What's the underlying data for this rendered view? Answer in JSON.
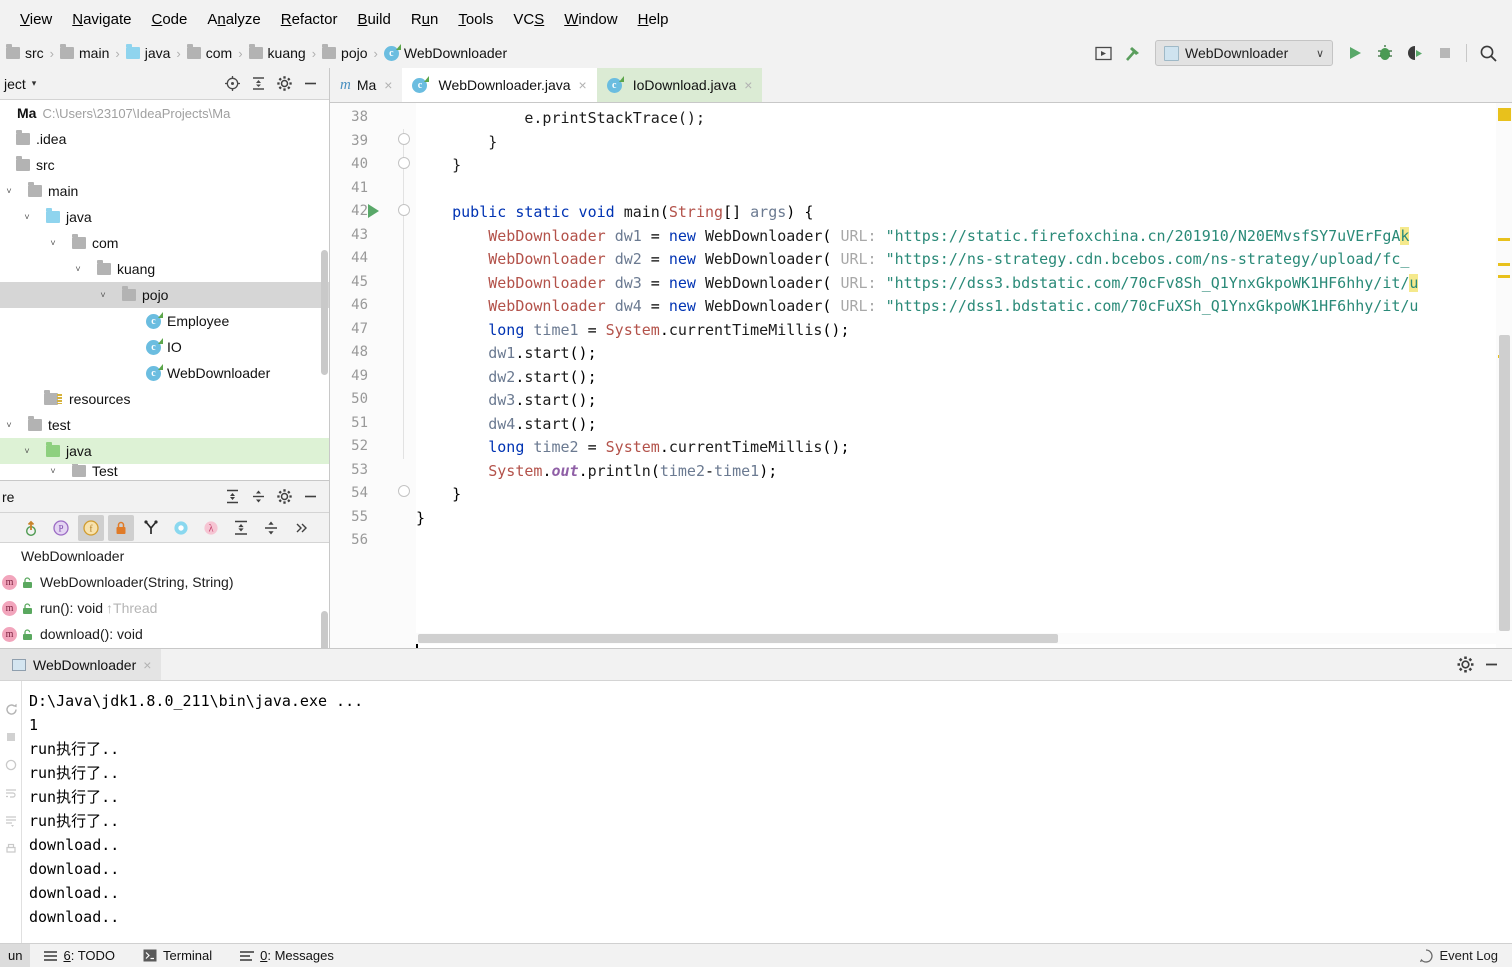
{
  "menu": {
    "items": [
      "View",
      "Navigate",
      "Code",
      "Analyze",
      "Refactor",
      "Build",
      "Run",
      "Tools",
      "VCS",
      "Window",
      "Help"
    ]
  },
  "breadcrumb": {
    "items": [
      {
        "label": "src",
        "icon": "folder-icon"
      },
      {
        "label": "main",
        "icon": "folder-icon"
      },
      {
        "label": "java",
        "icon": "folder-source-icon"
      },
      {
        "label": "com",
        "icon": "folder-icon"
      },
      {
        "label": "kuang",
        "icon": "folder-icon"
      },
      {
        "label": "pojo",
        "icon": "folder-icon"
      },
      {
        "label": "WebDownloader",
        "icon": "java-class-icon"
      }
    ],
    "separator": "›"
  },
  "toolbar": {
    "run_config_name": "WebDownloader",
    "run_config_chevron": "∨",
    "buttons": [
      {
        "name": "open-terminal-icon",
        "title": "Terminal"
      },
      {
        "name": "build-hammer-icon",
        "title": "Build"
      },
      {
        "name": "run-icon",
        "title": "Run"
      },
      {
        "name": "debug-icon",
        "title": "Debug"
      },
      {
        "name": "run-coverage-icon",
        "title": "Run with Coverage"
      },
      {
        "name": "stop-icon",
        "title": "Stop"
      },
      {
        "name": "search-icon",
        "title": "Search Everywhere"
      }
    ]
  },
  "project_panel": {
    "title": "ject",
    "caret": "▾",
    "tree": [
      {
        "indent": 0,
        "twist": "",
        "label": "Ma",
        "bold": true,
        "path": "C:\\Users\\23107\\IdeaProjects\\Ma",
        "icon": "none",
        "state": "none"
      },
      {
        "indent": 0,
        "twist": "",
        "label": ".idea",
        "icon": "folder-icon",
        "state": "none"
      },
      {
        "indent": 0,
        "twist": "",
        "label": "src",
        "icon": "folder-icon",
        "state": "none"
      },
      {
        "indent": 1,
        "twist": "˅",
        "label": "main",
        "icon": "folder-icon",
        "state": "none"
      },
      {
        "indent": 2,
        "twist": "˅",
        "label": "java",
        "icon": "folder-source-icon",
        "state": "none"
      },
      {
        "indent": 3,
        "twist": "˅",
        "label": "com",
        "icon": "folder-icon",
        "state": "none"
      },
      {
        "indent": 4,
        "twist": "˅",
        "label": "kuang",
        "icon": "folder-icon",
        "state": "none"
      },
      {
        "indent": 5,
        "twist": "˅",
        "label": "pojo",
        "icon": "folder-icon",
        "state": "selected"
      },
      {
        "indent": 6,
        "twist": "",
        "label": "Employee",
        "icon": "java-class-icon",
        "state": "none"
      },
      {
        "indent": 6,
        "twist": "",
        "label": "IO",
        "icon": "java-class-runnable-icon",
        "state": "none"
      },
      {
        "indent": 6,
        "twist": "",
        "label": "WebDownloader",
        "icon": "java-class-runnable-icon",
        "state": "none"
      },
      {
        "indent": 2,
        "twist": "",
        "label": "resources",
        "icon": "folder-resources-icon",
        "state": "none"
      },
      {
        "indent": 1,
        "twist": "˅",
        "label": "test",
        "icon": "folder-icon",
        "state": "none"
      },
      {
        "indent": 2,
        "twist": "˅",
        "label": "java",
        "icon": "folder-test-icon",
        "state": "focused"
      },
      {
        "indent": 3,
        "twist": "˅",
        "label": "Test",
        "icon": "folder-icon",
        "state": "none"
      }
    ],
    "header_icons": [
      "locate-icon",
      "collapse-all-icon",
      "gear-icon",
      "hide-icon"
    ]
  },
  "structure_panel": {
    "title": "re",
    "header_icons": [
      "expand-all-icon",
      "collapse-all-icon",
      "gear-icon",
      "hide-icon"
    ],
    "toolbar_icons": [
      {
        "name": "sort-by-visibility-icon",
        "active": false
      },
      {
        "name": "show-properties-icon",
        "active": false
      },
      {
        "name": "show-fields-icon",
        "active": true
      },
      {
        "name": "show-non-public-icon",
        "active": true
      },
      {
        "name": "show-inherited-icon",
        "active": false
      },
      {
        "name": "show-anonymous-icon",
        "active": false
      },
      {
        "name": "show-lambdas-icon",
        "active": false
      },
      {
        "name": "expand-all-icon",
        "active": false
      },
      {
        "name": "collapse-all-icon",
        "active": false
      },
      {
        "name": "more-chevrons-icon",
        "active": false
      }
    ],
    "items": [
      {
        "label": "WebDownloader",
        "kind": "class",
        "suffix": ""
      },
      {
        "label": "WebDownloader(String, String)",
        "kind": "method",
        "suffix": ""
      },
      {
        "label": "run(): void",
        "kind": "method",
        "suffix": "↑Thread"
      },
      {
        "label": "download(): void",
        "kind": "method",
        "suffix": ""
      }
    ]
  },
  "editor": {
    "tabs": [
      {
        "label": "Ma",
        "icon": "maven-icon",
        "state": "normal",
        "close": "×"
      },
      {
        "label": "WebDownloader.java",
        "icon": "java-class-runnable-icon",
        "state": "active",
        "close": "×"
      },
      {
        "label": "IoDownload.java",
        "icon": "java-class-runnable-icon",
        "state": "green",
        "close": "×"
      }
    ],
    "first_line": 38,
    "line_numbers": [
      38,
      39,
      40,
      41,
      42,
      43,
      44,
      45,
      46,
      47,
      48,
      49,
      50,
      51,
      52,
      53,
      54,
      55,
      56
    ],
    "lines": [
      {
        "n": 38,
        "text": "            e.printStackTrace();"
      },
      {
        "n": 39,
        "text": "        }"
      },
      {
        "n": 40,
        "text": "    }"
      },
      {
        "n": 41,
        "text": ""
      },
      {
        "n": 42,
        "text": "    public static void main(String[] args) {"
      },
      {
        "n": 43,
        "text": "        WebDownloader dw1 = new WebDownloader( URL: \"https://static.firefoxchina.cn/201910/N20EMvsfSY7uVErFgAk"
      },
      {
        "n": 44,
        "text": "        WebDownloader dw2 = new WebDownloader( URL: \"https://ns-strategy.cdn.bcebos.com/ns-strategy/upload/fc_"
      },
      {
        "n": 45,
        "text": "        WebDownloader dw3 = new WebDownloader( URL: \"https://dss3.bdstatic.com/70cFv8Sh_Q1YnxGkpoWK1HF6hhy/it/"
      },
      {
        "n": 46,
        "text": "        WebDownloader dw4 = new WebDownloader( URL: \"https://dss1.bdstatic.com/70cFuXSh_Q1YnxGkpoWK1HF6hhy/it/"
      },
      {
        "n": 47,
        "text": "        long time1 = System.currentTimeMillis();"
      },
      {
        "n": 48,
        "text": "        dw1.start();"
      },
      {
        "n": 49,
        "text": "        dw2.start();"
      },
      {
        "n": 50,
        "text": "        dw3.start();"
      },
      {
        "n": 51,
        "text": "        dw4.start();"
      },
      {
        "n": 52,
        "text": "        long time2 = System.currentTimeMillis();"
      },
      {
        "n": 53,
        "text": "        System.out.println(time2-time1);"
      },
      {
        "n": 54,
        "text": "    }"
      },
      {
        "n": 55,
        "text": "}"
      },
      {
        "n": 56,
        "text": ""
      }
    ],
    "gutter_run_line": 42
  },
  "run_panel": {
    "tab_label": "WebDownloader",
    "tab_close": "×",
    "header_icons": [
      "gear-icon",
      "hide-icon"
    ],
    "sidebar_icons": [
      "rerun-icon",
      "stop-icon",
      "trace-icon",
      "soft-wrap-icon",
      "scroll-to-end-icon",
      "print-icon"
    ],
    "console_lines": [
      "D:\\Java\\jdk1.8.0_211\\bin\\java.exe ...",
      "1",
      "run执行了..",
      "run执行了..",
      "run执行了..",
      "run执行了..",
      "download..",
      "download..",
      "download..",
      "download.."
    ]
  },
  "statusbar": {
    "run_label": "un",
    "items": [
      {
        "label": "6: TODO",
        "underline": "6",
        "icon": "todo-icon"
      },
      {
        "label": "Terminal",
        "underline": "",
        "icon": "terminal-icon"
      },
      {
        "label": "0: Messages",
        "underline": "0",
        "icon": "messages-icon"
      }
    ],
    "event_log": "Event Log"
  },
  "colors": {
    "chrome": "#f2f2f2",
    "accent_green": "#59a869",
    "string_green": "#2a8a78",
    "keyword_blue": "#0033b3",
    "class_red": "#b3524a",
    "warn_yellow": "#e8c11c",
    "selection_gray": "#d6d6d6",
    "selection_green": "#ddf2d5"
  }
}
